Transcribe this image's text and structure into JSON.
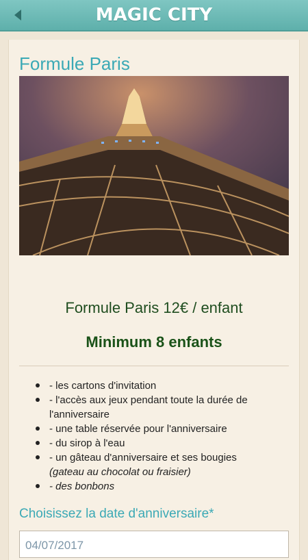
{
  "header": {
    "app_title": "MAGIC CITY",
    "back_icon": "back-arrow-icon",
    "bar_color": "#6dbdb8"
  },
  "page": {
    "title": "Formule Paris",
    "image_alt": "Eiffel Tower",
    "price_line": "Formule Paris 12€ / enfant",
    "minimum_line": "Minimum 8 enfants"
  },
  "features": [
    {
      "main": " - les cartons d'invitation",
      "extra": ""
    },
    {
      "main": " - l'accès aux jeux pendant toute la durée de l'anniversaire",
      "extra": ""
    },
    {
      "main": " - une table réservée pour l'anniversaire",
      "extra": ""
    },
    {
      "main": " - du sirop à l'eau",
      "extra": ""
    },
    {
      "main": " - un gâteau d'anniversaire et ses bougies ",
      "extra": "(gateau au chocolat ou fraisier)"
    },
    {
      "main": "",
      "extra": " - des bonbons"
    }
  ],
  "date": {
    "label": "Choisissez la date d'anniversaire*",
    "value": "04/07/2017"
  },
  "colors": {
    "accent": "#3ba9b5",
    "price": "#1f4d1f",
    "minimum": "#1a5218"
  }
}
